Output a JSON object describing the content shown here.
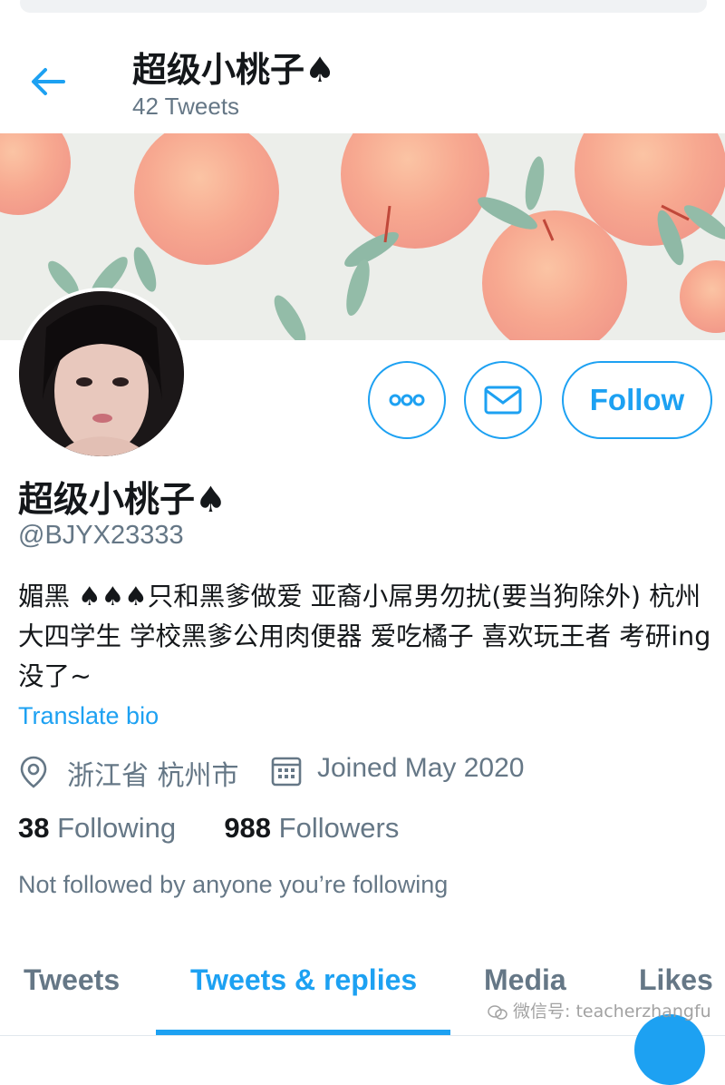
{
  "header": {
    "title": "超级小桃子♠",
    "tweet_count": "42 Tweets"
  },
  "profile": {
    "name": "超级小桃子♠",
    "handle": "@BJYX23333",
    "bio": "媚黑  ♠♠♠只和黑爹做爱 亚裔小屌男勿扰(要当狗除外) 杭州大四学生 学校黑爹公用肉便器 爱吃橘子 喜欢玩王者 考研ing  没了~",
    "translate_label": "Translate bio",
    "location": "浙江省 杭州市",
    "joined": "Joined May 2020",
    "following_count": "38",
    "following_label": "Following",
    "followers_count": "988",
    "followers_label": "Followers",
    "not_followed": "Not followed by anyone you’re following"
  },
  "actions": {
    "follow_label": "Follow"
  },
  "tabs": [
    {
      "label": "Tweets",
      "active": false
    },
    {
      "label": "Tweets & replies",
      "active": true
    },
    {
      "label": "Media",
      "active": false
    },
    {
      "label": "Likes",
      "active": false
    }
  ],
  "watermark": "微信号: teacherzhangfu",
  "icons": {
    "back": "back-arrow-icon",
    "more": "more-options-icon",
    "message": "envelope-icon",
    "location": "location-pin-icon",
    "calendar": "calendar-icon"
  },
  "colors": {
    "accent": "#1da1f2",
    "secondary_text": "#657786",
    "primary_text": "#14171a"
  }
}
